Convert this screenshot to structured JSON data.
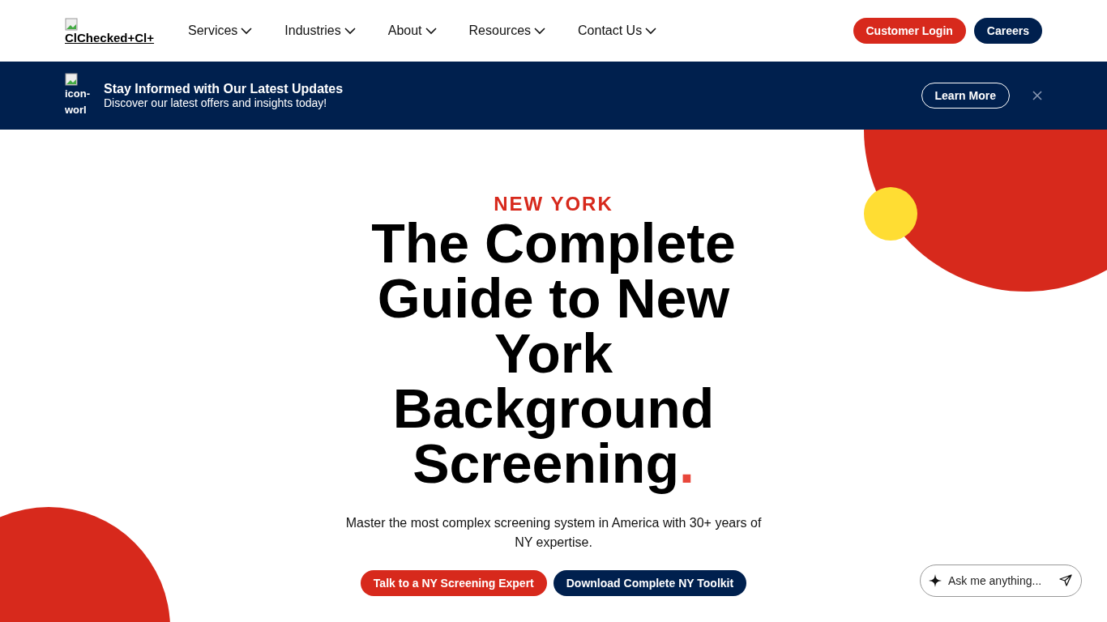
{
  "header": {
    "logo_alt": "ClChecked+Cl+",
    "nav": [
      {
        "label": "Services",
        "expanded": false
      },
      {
        "label": "Industries",
        "expanded": false
      },
      {
        "label": "About",
        "expanded": false
      },
      {
        "label": "Resources",
        "expanded": false
      },
      {
        "label": "Contact Us",
        "expanded": false
      }
    ],
    "buttons": [
      {
        "label": "Customer Login",
        "kind": "primary"
      },
      {
        "label": "Careers",
        "kind": "secondary"
      }
    ]
  },
  "banner": {
    "icon_alt": "icon-worl",
    "title": "Stay Informed with Our Latest Updates",
    "text": "Discover our latest offers and insights today!",
    "button": "Learn More"
  },
  "hero": {
    "eyebrow": "NEW YORK",
    "title": "The Complete Guide to New York Background Screening",
    "title_end": ".",
    "subtitle": "Master the most complex screening system in America with 30+ years of NY expertise.",
    "buttons": [
      {
        "label": "Talk to a NY Screening Expert",
        "kind": "primary"
      },
      {
        "label": "Download Complete NY Toolkit",
        "kind": "secondary"
      }
    ]
  },
  "chat": {
    "placeholder": "Ask me anything..."
  }
}
